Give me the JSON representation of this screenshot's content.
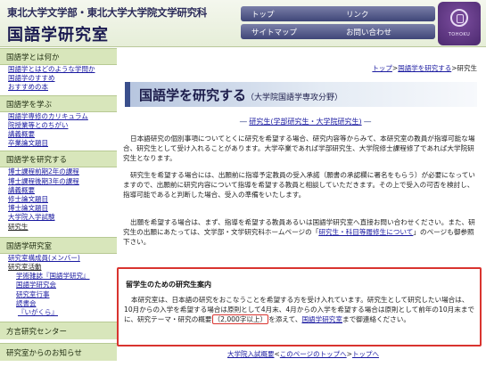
{
  "header": {
    "subtitle": "東北大学文学部・東北大学大学院文学研究科",
    "title": "国語学研究室",
    "nav": [
      "トップ",
      "リンク",
      "サイトマップ",
      "お問い合わせ"
    ],
    "logo_text": "TOHOKU"
  },
  "sidebar": {
    "sections": [
      {
        "title": "国語学とは何か",
        "links": [
          "国語学とはどのような学問か",
          "国語学のすすめ",
          "おすすめの本"
        ]
      },
      {
        "title": "国語学を学ぶ",
        "links": [
          "国語学専修のカリキュラム",
          "院授業等とのちがい",
          "講義概要",
          "卒業論文題目"
        ]
      },
      {
        "title": "国語学を研究する",
        "links": [
          "博士課程前期2年の課程",
          "博士課程後期3年の課程",
          "講義概要",
          "修士論文題目",
          "博士論文題目",
          "大学院入学試験",
          "研究生"
        ]
      },
      {
        "title": "国語学研究室",
        "links": [
          "研究室構成員(メンバー)",
          "研究室活動"
        ],
        "sublinks": [
          "学術雑誌『国語学研究』",
          "国語学研究会",
          "研究室行事",
          "読書会",
          "『いがくら』"
        ]
      }
    ],
    "bottom": [
      "方言研究センター",
      "研究室からのお知らせ"
    ]
  },
  "breadcrumb": {
    "items": [
      "トップ",
      "国語学を研究する",
      "研究生"
    ],
    "sep": ">"
  },
  "heading": {
    "title": "国語学を研究する",
    "subtitle": "（大学院国語学専攻分野）"
  },
  "section_title": {
    "text": "研究生(学部研究生・大学院研究生)",
    "dash": "―"
  },
  "paragraphs": [
    "日本語研究の個別事項についてとくに研究を希望する場合、研究内容等からみて、本研究室の教員が指導可能な場合、研究生として受け入れることがあります。大学卒業であれば学部研究生、大学院修士課程修了であれば大学院研究生となります。",
    "研究生を希望する場合には、出願前に指導予定教員の受入承諾（願書の承認欄に署名をもらう）が必要になっていますので、出願前に研究内容について指導を希望する教員と相談していただきます。その上で受入の可否を検討し、指導可能であると判断した場合、受入の準備をいたします。",
    "出願を希望する場合は、まず、指導を希望する教員あるいは国語学研究室へ直接お問い合わせください。また、研究生の出願にあたっては、文学部・文学研究科ホームページの「",
    "」のページも御参照下さい。"
  ],
  "links": {
    "research_student_info": "研究生・科目等履修生について",
    "research_office": "国語学研究室"
  },
  "notice": {
    "title": "留学生のための研究生案内",
    "body_before": "本研究室は、日本語の研究をおこなうことを希望する方を受け入れています。研究生として研究したい場合は、10月からの入学を希望する場合は原則として4月末、4月からの入学を希望する場合は原則として前年の10月末までに、研究テーマ・研究の概要",
    "highlight": "（2,000字以上）",
    "body_mid": "を添えて、",
    "body_after": "まで御連絡ください。"
  },
  "footer_nav": {
    "items": [
      "大学院入試概要",
      "このページのトップへ",
      "トップへ"
    ],
    "sep": "<",
    "sep2": ">"
  }
}
